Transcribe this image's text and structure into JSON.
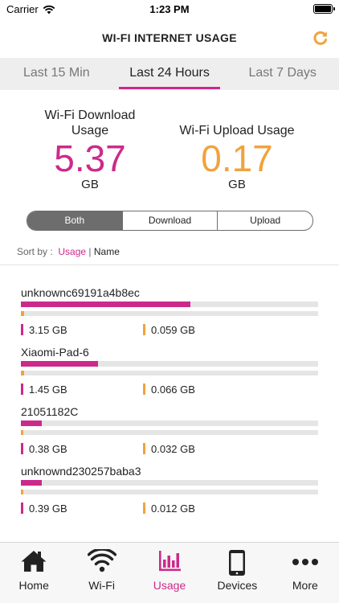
{
  "status": {
    "carrier": "Carrier",
    "time": "1:23 PM"
  },
  "header": {
    "title": "WI-FI INTERNET USAGE"
  },
  "tabs": [
    {
      "label": "Last 15 Min"
    },
    {
      "label": "Last 24 Hours"
    },
    {
      "label": "Last 7 Days"
    }
  ],
  "summary": {
    "download": {
      "label": "Wi-Fi Download Usage",
      "value": "5.37",
      "unit": "GB"
    },
    "upload": {
      "label": "Wi-Fi Upload Usage",
      "value": "0.17",
      "unit": "GB"
    }
  },
  "segments": [
    {
      "label": "Both"
    },
    {
      "label": "Download"
    },
    {
      "label": "Upload"
    }
  ],
  "sort": {
    "prefix": "Sort by :",
    "usage": "Usage",
    "separator": "|",
    "name": "Name"
  },
  "devices": [
    {
      "name": "unknownc69191a4b8ec",
      "download": "3.15 GB",
      "upload": "0.059 GB",
      "download_fraction": 0.57,
      "upload_fraction": 0.011
    },
    {
      "name": "Xiaomi-Pad-6",
      "download": "1.45 GB",
      "upload": "0.066 GB",
      "download_fraction": 0.26,
      "upload_fraction": 0.012
    },
    {
      "name": "21051182C",
      "download": "0.38 GB",
      "upload": "0.032 GB",
      "download_fraction": 0.07,
      "upload_fraction": 0.006
    },
    {
      "name": "unknownd230257baba3",
      "download": "0.39 GB",
      "upload": "0.012 GB",
      "download_fraction": 0.07,
      "upload_fraction": 0.003
    }
  ],
  "tabbar": [
    {
      "label": "Home",
      "icon": "home-icon"
    },
    {
      "label": "Wi-Fi",
      "icon": "wifi-icon"
    },
    {
      "label": "Usage",
      "icon": "usage-chart-icon"
    },
    {
      "label": "Devices",
      "icon": "phone-icon"
    },
    {
      "label": "More",
      "icon": "more-icon"
    }
  ],
  "colors": {
    "accent": "#cc2a8b",
    "upload": "#f0a33c",
    "segment_active": "#6d6d6d"
  }
}
